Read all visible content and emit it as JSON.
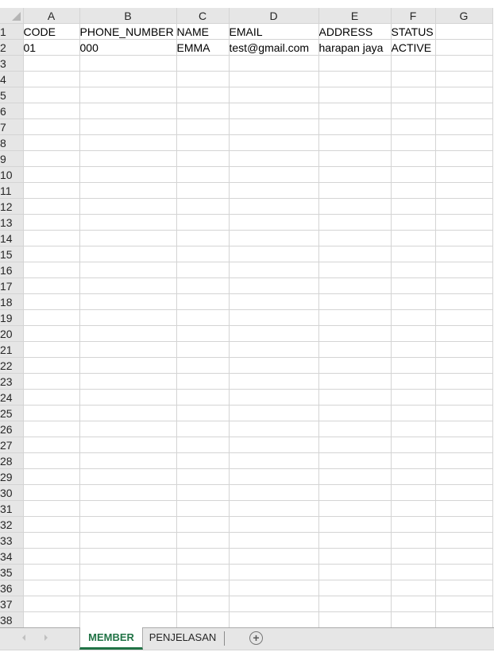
{
  "spreadsheet": {
    "columns": [
      "A",
      "B",
      "C",
      "D",
      "E",
      "F",
      "G"
    ],
    "rows": [
      [
        "CODE",
        "PHONE_NUMBER",
        "NAME",
        "EMAIL",
        "ADDRESS",
        "STATUS",
        ""
      ],
      [
        "01",
        "000",
        "EMMA",
        "test@gmail.com",
        "harapan jaya",
        "ACTIVE",
        ""
      ]
    ],
    "visible_row_count": 38
  },
  "sheet_tabs": {
    "tabs": [
      {
        "label": "MEMBER",
        "active": true
      },
      {
        "label": "PENJELASAN",
        "active": false
      }
    ],
    "add_sheet_icon": "plus-circle-icon",
    "nav_prev_icon": "chevron-left-icon",
    "nav_next_icon": "chevron-right-icon"
  },
  "colors": {
    "accent": "#217346",
    "header_bg": "#e6e6e6",
    "gridline": "#d4d4d4"
  }
}
